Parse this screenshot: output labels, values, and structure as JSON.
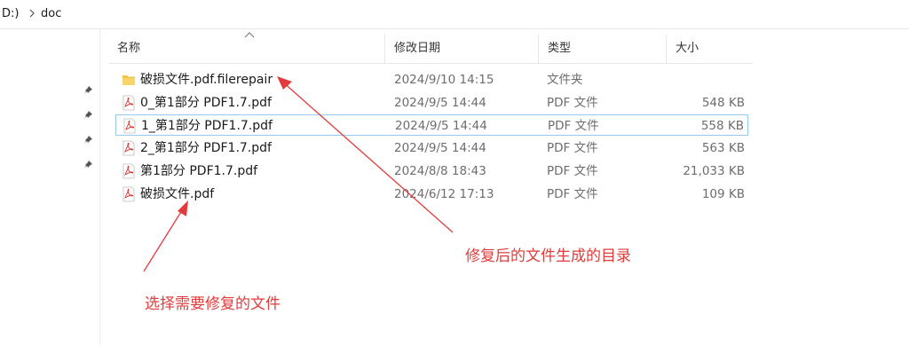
{
  "breadcrumb": {
    "drive": "D:)",
    "folder": "doc"
  },
  "columns": {
    "name": "名称",
    "date": "修改日期",
    "type": "类型",
    "size": "大小"
  },
  "files": [
    {
      "name": "破损文件.pdf.filerepair",
      "date": "2024/9/10 14:15",
      "type": "文件夹",
      "size": "",
      "icon": "folder-icon"
    },
    {
      "name": "0_第1部分 PDF1.7.pdf",
      "date": "2024/9/5 14:44",
      "type": "PDF 文件",
      "size": "548 KB",
      "icon": "pdf-icon"
    },
    {
      "name": "1_第1部分 PDF1.7.pdf",
      "date": "2024/9/5 14:44",
      "type": "PDF 文件",
      "size": "558 KB",
      "icon": "pdf-icon"
    },
    {
      "name": "2_第1部分 PDF1.7.pdf",
      "date": "2024/9/5 14:44",
      "type": "PDF 文件",
      "size": "563 KB",
      "icon": "pdf-icon"
    },
    {
      "name": "第1部分 PDF1.7.pdf",
      "date": "2024/8/8 18:43",
      "type": "PDF 文件",
      "size": "21,033 KB",
      "icon": "pdf-icon"
    },
    {
      "name": "破损文件.pdf",
      "date": "2024/6/12 17:13",
      "type": "PDF 文件",
      "size": "109 KB",
      "icon": "pdf-icon"
    }
  ],
  "annotations": {
    "repair_output": "修复后的文件生成的目录",
    "select_file": "选择需要修复的文件"
  },
  "colors": {
    "annotation": "#e23b3b",
    "selection_border": "#99c9ef",
    "folder": "#f0c24b",
    "pdf": "#d9302c"
  }
}
